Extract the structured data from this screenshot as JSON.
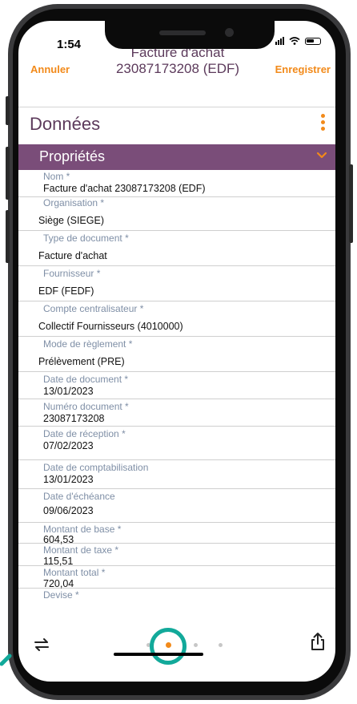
{
  "status": {
    "time": "1:54"
  },
  "nav": {
    "cancel_label": "Annuler",
    "title_line1": "Facture d'achat",
    "title_line2": "23087173208 (EDF)",
    "save_label": "Enregistrer"
  },
  "section": {
    "title": "Données",
    "menu_icon": "kebab-icon"
  },
  "banner": {
    "title": "Propriétés",
    "chevron_icon": "chevron-down-icon"
  },
  "fields": [
    {
      "label": "Nom *",
      "value": "Facture d'achat 23087173208 (EDF)"
    },
    {
      "label": "Organisation *",
      "value": "Siège (SIEGE)"
    },
    {
      "label": "Type de document *",
      "value": "Facture d'achat"
    },
    {
      "label": "Fournisseur *",
      "value": "EDF (FEDF)"
    },
    {
      "label": "Compte centralisateur *",
      "value": "Collectif Fournisseurs (4010000)"
    },
    {
      "label": "Mode de règlement *",
      "value": "Prélèvement (PRE)"
    },
    {
      "label": "Date de document *",
      "value": "13/01/2023"
    },
    {
      "label": "Numéro document *",
      "value": "23087173208"
    },
    {
      "label": "Date de réception *",
      "value": "07/02/2023"
    },
    {
      "label": "Date de comptabilisation",
      "value": "13/01/2023"
    },
    {
      "label": "Date d'échéance",
      "value": "09/06/2023"
    },
    {
      "label": "Montant de base *",
      "value": "604,53"
    },
    {
      "label": "Montant de taxe *",
      "value": "115,51"
    },
    {
      "label": "Montant total *",
      "value": "720,04"
    },
    {
      "label": "Devise *",
      "value": ""
    }
  ],
  "bottom": {
    "left_icon": "swap-icon",
    "right_icon": "share-icon",
    "page_count": 4,
    "active_page": 2
  },
  "colors": {
    "accent": "#f28a1a",
    "brand_purple": "#7a4d79",
    "title_purple": "#5c3a5b",
    "label_gray": "#7f8fa6",
    "highlight_ring": "#12a99a"
  }
}
